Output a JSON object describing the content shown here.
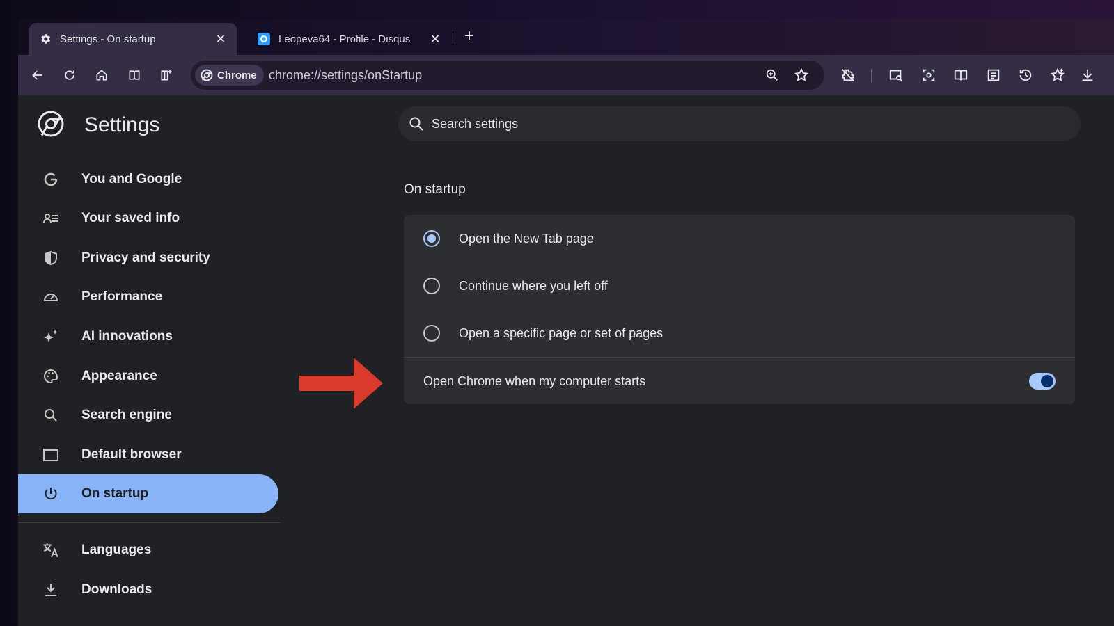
{
  "tabs": [
    {
      "title": "Settings - On startup",
      "icon": "gear-icon",
      "active": true
    },
    {
      "title": "Leopeva64 - Profile - Disqus",
      "icon": "disqus-icon",
      "active": false
    }
  ],
  "toolbar": {
    "chip_label": "Chrome",
    "url": "chrome://settings/onStartup"
  },
  "settings": {
    "title": "Settings",
    "search_placeholder": "Search settings"
  },
  "nav": [
    {
      "label": "You and Google",
      "icon": "google-g-icon"
    },
    {
      "label": "Your saved info",
      "icon": "saved-info-icon"
    },
    {
      "label": "Privacy and security",
      "icon": "shield-icon"
    },
    {
      "label": "Performance",
      "icon": "gauge-icon"
    },
    {
      "label": "AI innovations",
      "icon": "sparkle-icon"
    },
    {
      "label": "Appearance",
      "icon": "palette-icon"
    },
    {
      "label": "Search engine",
      "icon": "search-icon"
    },
    {
      "label": "Default browser",
      "icon": "browser-window-icon"
    },
    {
      "label": "On startup",
      "icon": "power-icon",
      "selected": true
    },
    {
      "label": "Languages",
      "icon": "translate-icon"
    },
    {
      "label": "Downloads",
      "icon": "download-icon"
    }
  ],
  "on_startup": {
    "section_title": "On startup",
    "options": [
      {
        "label": "Open the New Tab page",
        "checked": true
      },
      {
        "label": "Continue where you left off",
        "checked": false
      },
      {
        "label": "Open a specific page or set of pages",
        "checked": false
      }
    ],
    "toggle_label": "Open Chrome when my computer starts",
    "toggle_on": true
  },
  "colors": {
    "accent": "#8ab4f8",
    "arrow": "#d93a2b",
    "toggle_track": "#a8c7fa"
  }
}
